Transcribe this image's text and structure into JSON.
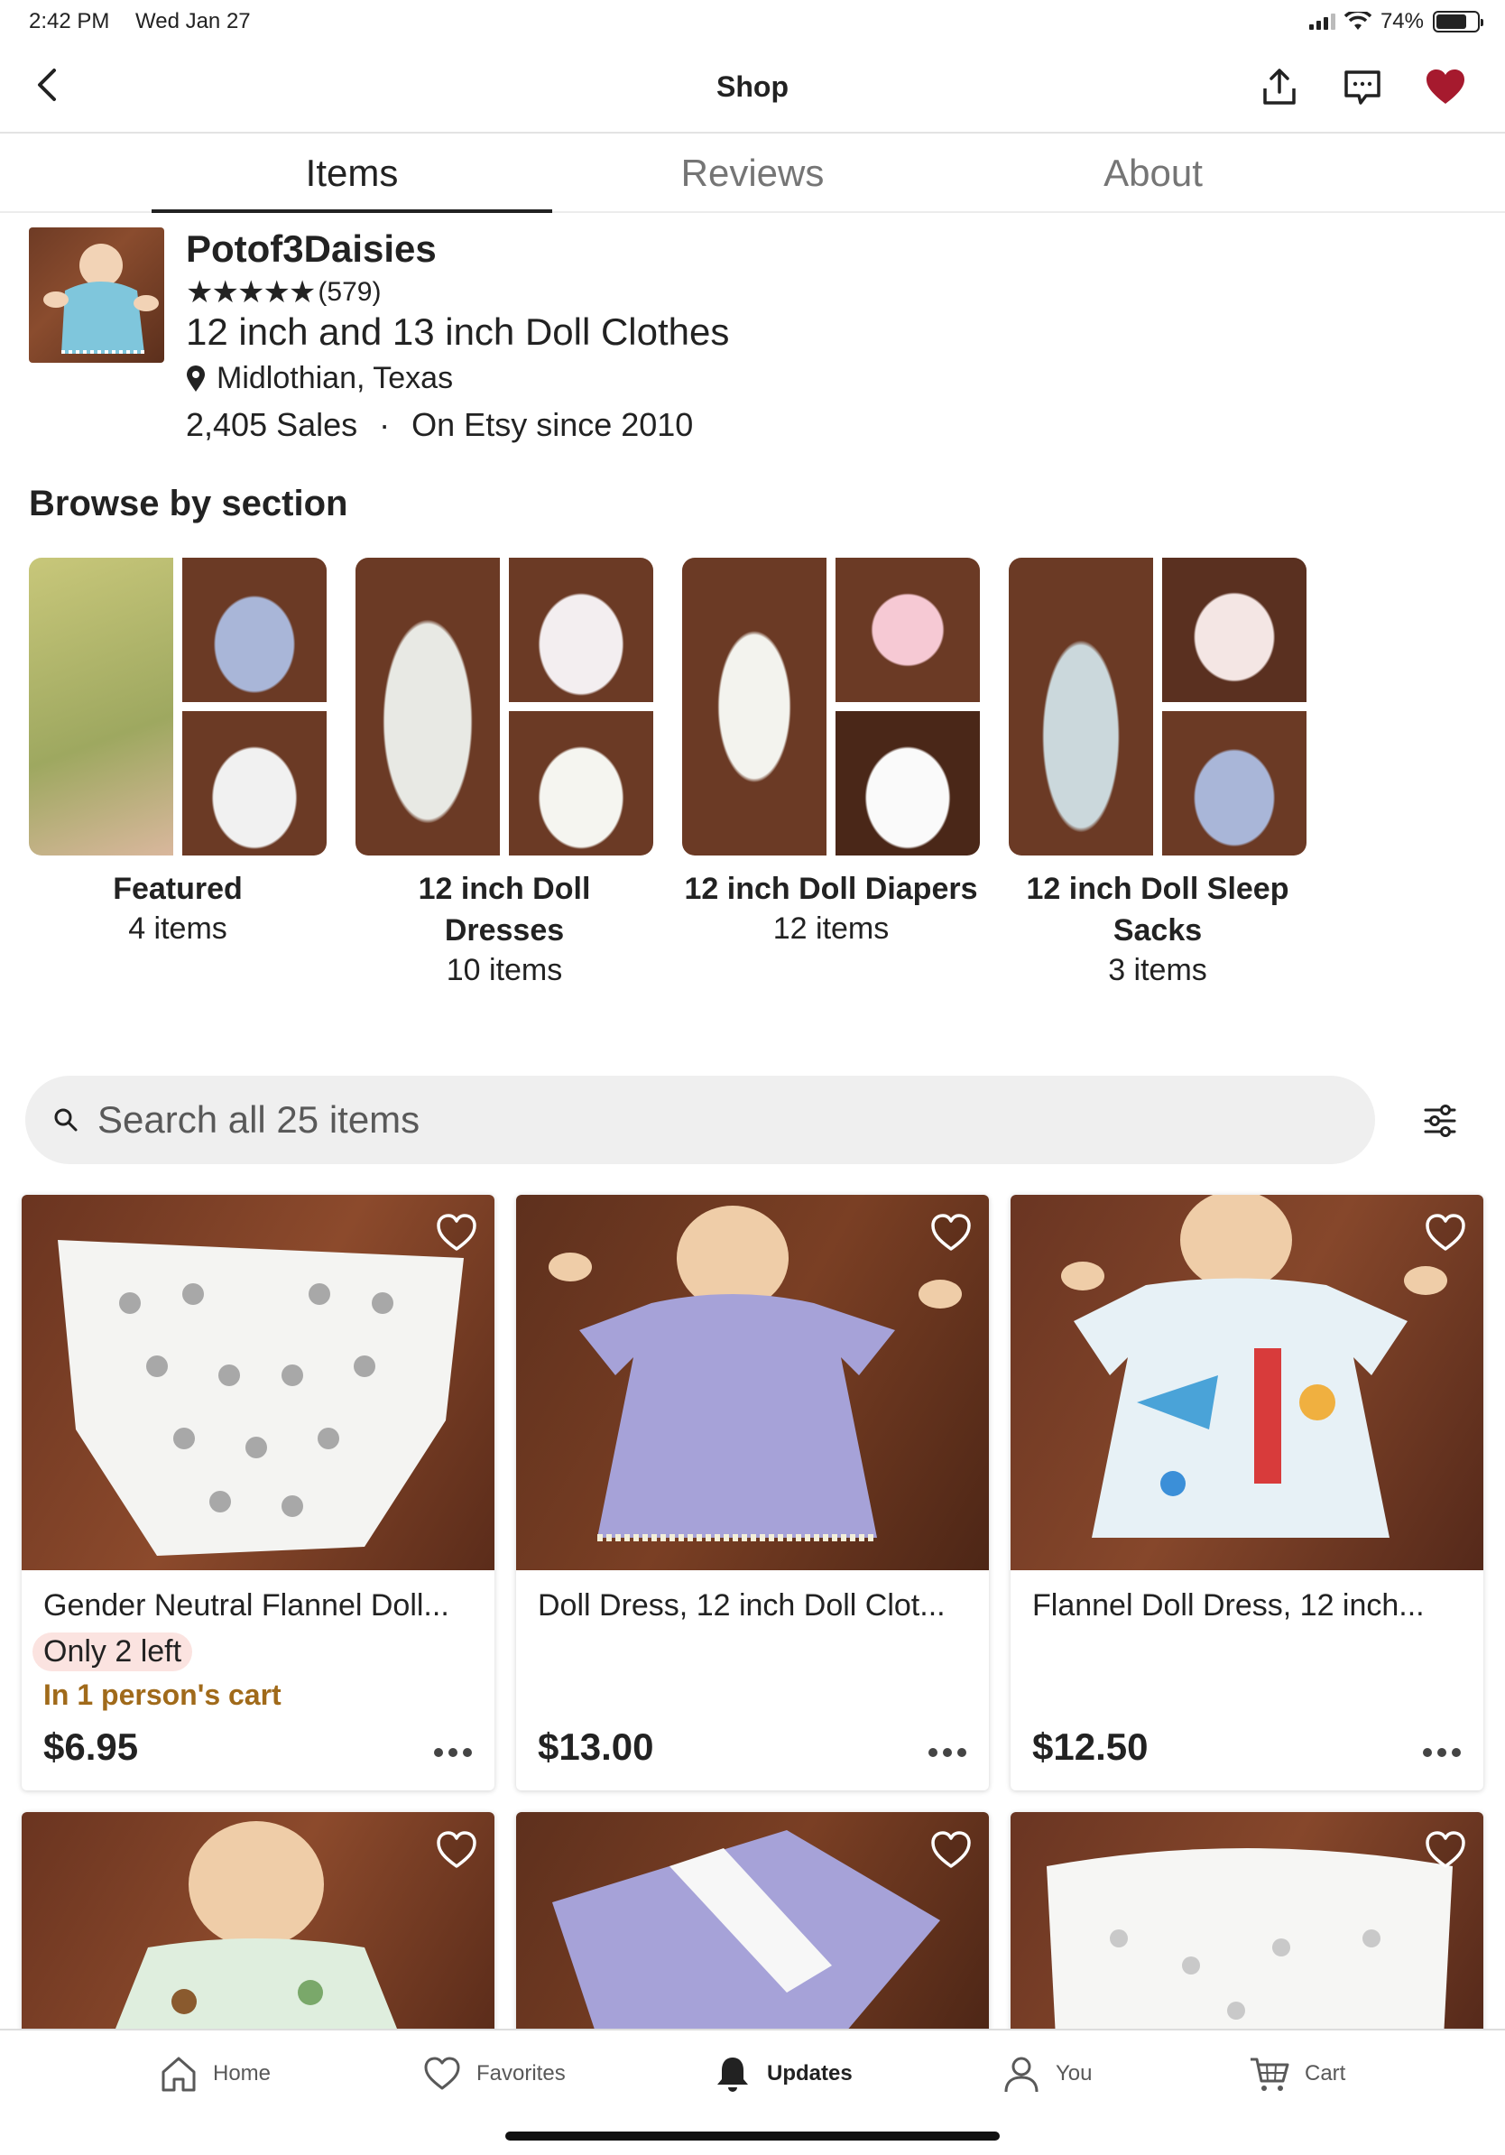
{
  "status_bar": {
    "time": "2:42 PM",
    "date": "Wed Jan 27",
    "battery": "74%",
    "battery_level": 0.74
  },
  "nav": {
    "title": "Shop",
    "favorited": true,
    "accent_color": "#a61a2e"
  },
  "tabs": [
    {
      "label": "Items",
      "active": true
    },
    {
      "label": "Reviews",
      "active": false
    },
    {
      "label": "About",
      "active": false
    }
  ],
  "shop": {
    "name": "Potof3Daisies",
    "stars": "★★★★★",
    "rating_count": "(579)",
    "description": "12 inch and 13 inch Doll Clothes",
    "location": "Midlothian, Texas",
    "sales": "2,405 Sales",
    "separator": "·",
    "since": "On Etsy since 2010"
  },
  "browse": {
    "title": "Browse by section",
    "sections": [
      {
        "name": "Featured",
        "count": "4 items"
      },
      {
        "name": "12 inch Doll Dresses",
        "count": "10 items"
      },
      {
        "name": "12 inch Doll Diapers",
        "count": "12 items"
      },
      {
        "name": "12 inch Doll Sleep Sacks",
        "count": "3 items"
      }
    ]
  },
  "search": {
    "placeholder": "Search all 25 items"
  },
  "listings": [
    {
      "title": "Gender Neutral Flannel Doll...",
      "badge": "Only 2 left",
      "cart_note": "In 1 person's cart",
      "price": "$6.95"
    },
    {
      "title": "Doll Dress, 12 inch Doll Clot...",
      "price": "$13.00"
    },
    {
      "title": "Flannel Doll Dress, 12 inch...",
      "price": "$12.50"
    }
  ],
  "tabbar": [
    {
      "label": "Home",
      "icon": "home-icon",
      "active": false
    },
    {
      "label": "Favorites",
      "icon": "heart-outline-icon",
      "active": false
    },
    {
      "label": "Updates",
      "icon": "bell-icon",
      "active": true
    },
    {
      "label": "You",
      "icon": "person-icon",
      "active": false
    },
    {
      "label": "Cart",
      "icon": "cart-icon",
      "active": false
    }
  ]
}
